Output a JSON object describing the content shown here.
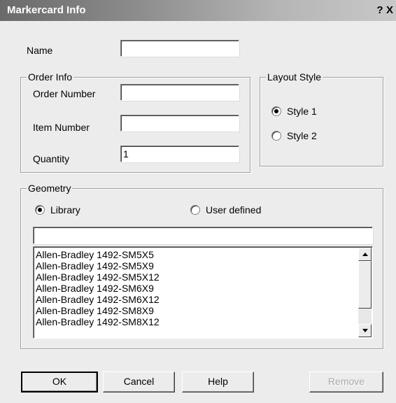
{
  "window": {
    "title": "Markercard Info",
    "help_glyph": "?",
    "close_glyph": "X"
  },
  "name_field": {
    "label": "Name",
    "value": ""
  },
  "order_info": {
    "title": "Order Info",
    "order_number": {
      "label": "Order Number",
      "value": ""
    },
    "item_number": {
      "label": "Item Number",
      "value": ""
    },
    "quantity": {
      "label": "Quantity",
      "value": "1"
    }
  },
  "layout_style": {
    "title": "Layout Style",
    "options": [
      {
        "label": "Style 1",
        "selected": true
      },
      {
        "label": "Style 2",
        "selected": false
      }
    ]
  },
  "geometry": {
    "title": "Geometry",
    "options": [
      {
        "label": "Library",
        "selected": true
      },
      {
        "label": "User defined",
        "selected": false
      }
    ],
    "filter_value": "",
    "items": [
      "Allen-Bradley 1492-SM5X5",
      "Allen-Bradley 1492-SM5X9",
      "Allen-Bradley 1492-SM5X12",
      "Allen-Bradley 1492-SM6X9",
      "Allen-Bradley 1492-SM6X12",
      "Allen-Bradley 1492-SM8X9",
      "Allen-Bradley 1492-SM8X12"
    ]
  },
  "buttons": {
    "ok": "OK",
    "cancel": "Cancel",
    "help": "Help",
    "remove": "Remove"
  }
}
